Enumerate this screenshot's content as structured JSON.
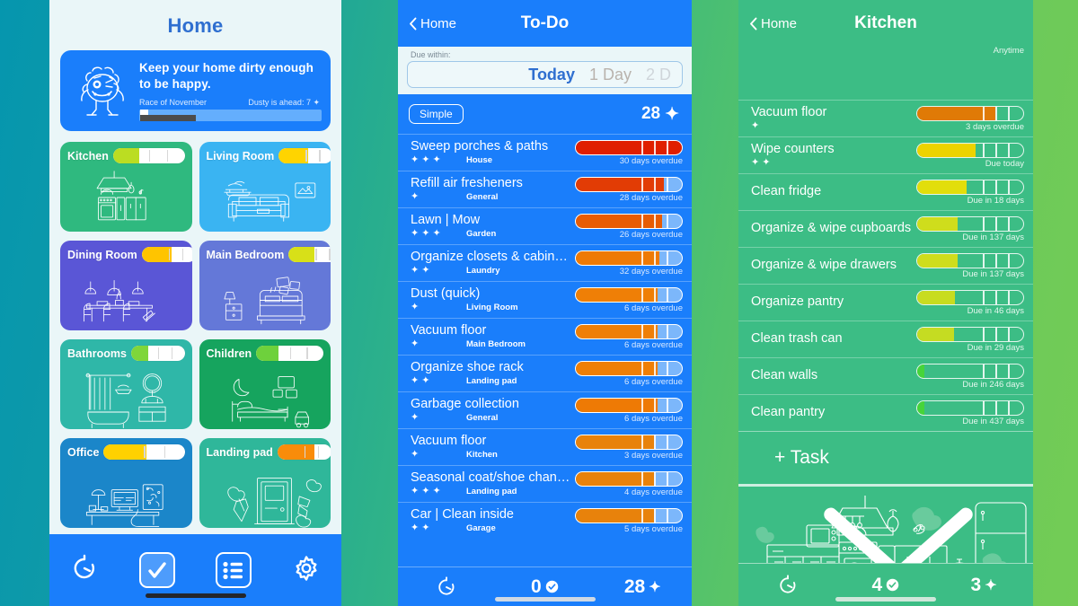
{
  "background": {
    "left_color": "#0596ae",
    "right_color": "#73cc55"
  },
  "home": {
    "title": "Home",
    "dusty_card": {
      "quote": "Keep your home dirty enough to be happy.",
      "race_label": "Race of November",
      "race_status": "Dusty is ahead: 7",
      "progress_percent": 19
    },
    "rooms": [
      {
        "name": "Kitchen",
        "fill_percent": 36,
        "fill_color": "#bbdd22",
        "bg": "#2fb97f",
        "art": "kitchen"
      },
      {
        "name": "Living Room",
        "fill_percent": 55,
        "fill_color": "#ffd400",
        "bg": "#3ab4f2",
        "art": "living"
      },
      {
        "name": "Dining Room",
        "fill_percent": 56,
        "fill_color": "#ffc400",
        "bg": "#5a56d6",
        "art": "dining"
      },
      {
        "name": "Main Bedroom",
        "fill_percent": 47,
        "fill_color": "#d8e018",
        "bg": "#6478d8",
        "art": "bedroom"
      },
      {
        "name": "Bathrooms",
        "fill_percent": 31,
        "fill_color": "#7fd63a",
        "bg": "#2fb7a8",
        "art": "bath"
      },
      {
        "name": "Children",
        "fill_percent": 33,
        "fill_color": "#6ed13c",
        "bg": "#16a45e",
        "art": "children"
      },
      {
        "name": "Office",
        "fill_percent": 53,
        "fill_color": "#ffd100",
        "bg": "#1b86c9",
        "art": "office"
      },
      {
        "name": "Landing pad",
        "fill_percent": 68,
        "fill_color": "#f98c0a",
        "bg": "#2fb79a",
        "art": "landing"
      }
    ],
    "tabbar": [
      {
        "icon": "timer-icon",
        "label": "",
        "active": false
      },
      {
        "icon": "checkbox-icon",
        "label": "",
        "active": true
      },
      {
        "icon": "list-icon",
        "label": "",
        "active": false
      },
      {
        "icon": "gear-icon",
        "label": "",
        "active": false
      }
    ]
  },
  "todo": {
    "back_label": "Home",
    "title": "To-Do",
    "due_within_label": "Due within:",
    "due_options": [
      {
        "label": "Today",
        "state": "active"
      },
      {
        "label": "1 Day",
        "state": "normal"
      },
      {
        "label": "2 D",
        "state": "dim"
      }
    ],
    "filter_button": "Simple",
    "pending_count": "28",
    "tasks": [
      {
        "name": "Sweep porches & paths",
        "zone": "House",
        "dusts": 3,
        "due": "30 days overdue",
        "fill_percent": 100,
        "color": "#e01f00"
      },
      {
        "name": "Refill air fresheners",
        "zone": "General",
        "dusts": 1,
        "due": "28 days overdue",
        "fill_percent": 83,
        "color": "#e23c05"
      },
      {
        "name": "Lawn | Mow",
        "zone": "Garden",
        "dusts": 3,
        "due": "26 days overdue",
        "fill_percent": 81,
        "color": "#e85c04"
      },
      {
        "name": "Organize closets & cabin…",
        "zone": "Laundry",
        "dusts": 2,
        "due": "32 days overdue",
        "fill_percent": 79,
        "color": "#ee7a05"
      },
      {
        "name": "Dust (quick)",
        "zone": "Living Room",
        "dusts": 1,
        "due": "6 days overdue",
        "fill_percent": 77,
        "color": "#ef7f06"
      },
      {
        "name": "Vacuum floor",
        "zone": "Main Bedroom",
        "dusts": 1,
        "due": "6 days overdue",
        "fill_percent": 77,
        "color": "#ef7f06"
      },
      {
        "name": "Organize shoe rack",
        "zone": "Landing pad",
        "dusts": 2,
        "due": "6 days overdue",
        "fill_percent": 77,
        "color": "#ef7f06"
      },
      {
        "name": "Garbage collection",
        "zone": "General",
        "dusts": 1,
        "due": "6 days overdue",
        "fill_percent": 77,
        "color": "#ee7a05"
      },
      {
        "name": "Vacuum floor",
        "zone": "Kitchen",
        "dusts": 1,
        "due": "3 days overdue",
        "fill_percent": 74,
        "color": "#e8820b"
      },
      {
        "name": "Seasonal coat/shoe chan…",
        "zone": "Landing pad",
        "dusts": 3,
        "due": "4 days overdue",
        "fill_percent": 74,
        "color": "#e8820b"
      },
      {
        "name": "Car | Clean inside",
        "zone": "Garage",
        "dusts": 2,
        "due": "5 days overdue",
        "fill_percent": 74,
        "color": "#e8820b"
      }
    ],
    "tabbar": {
      "timer_icon": "timer-icon",
      "done_count": "0",
      "pending_count": "28"
    }
  },
  "kitchen": {
    "back_label": "Home",
    "title": "Kitchen",
    "clipped_row": {
      "due": "Anytime"
    },
    "tasks": [
      {
        "name": "Vacuum floor",
        "dusts": 1,
        "due": "3 days overdue",
        "fill_percent": 74,
        "color": "#e07a06"
      },
      {
        "name": "Wipe counters",
        "dusts": 2,
        "due": "Due today",
        "fill_percent": 55,
        "color": "#edd300"
      },
      {
        "name": "Clean fridge",
        "dusts": 0,
        "due": "Due in 18 days",
        "fill_percent": 47,
        "color": "#e2de0b"
      },
      {
        "name": "Organize & wipe cupboards",
        "dusts": 0,
        "due": "Due in 137 days",
        "fill_percent": 38,
        "color": "#cfdd1c"
      },
      {
        "name": "Organize & wipe drawers",
        "dusts": 0,
        "due": "Due in 137 days",
        "fill_percent": 38,
        "color": "#cfdd1c"
      },
      {
        "name": "Organize pantry",
        "dusts": 0,
        "due": "Due in 46 days",
        "fill_percent": 36,
        "color": "#c8dc20"
      },
      {
        "name": "Clean trash can",
        "dusts": 0,
        "due": "Due in 29 days",
        "fill_percent": 35,
        "color": "#c5dc22"
      },
      {
        "name": "Clean walls",
        "dusts": 0,
        "due": "Due in 246 days",
        "fill_percent": 7,
        "color": "#46d43a"
      },
      {
        "name": "Clean pantry",
        "dusts": 0,
        "due": "Due in 437 days",
        "fill_percent": 7,
        "color": "#46d43a"
      }
    ],
    "add_task_label": "+ Task",
    "tabbar": {
      "timer_icon": "timer-icon",
      "done_count": "4",
      "pending_count": "3"
    }
  }
}
